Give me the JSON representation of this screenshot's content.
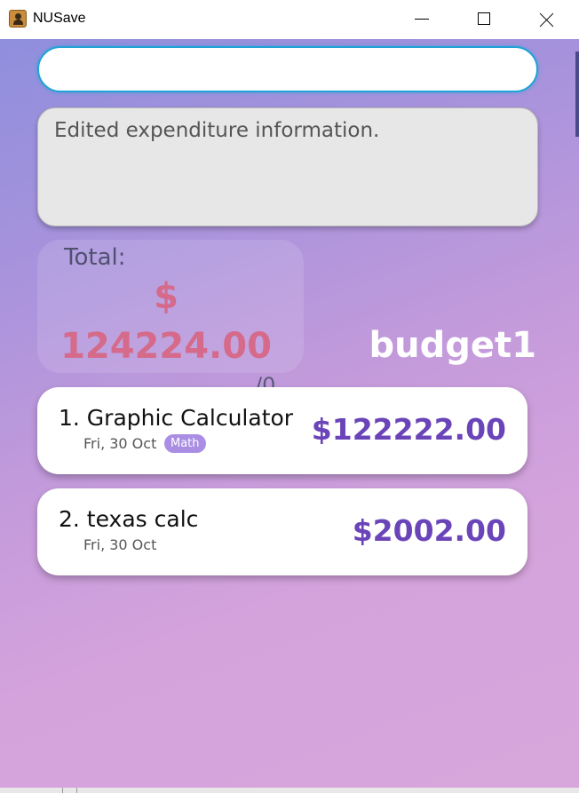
{
  "window": {
    "title": "NUSave",
    "icon": "address-book-icon"
  },
  "command": {
    "value": "",
    "placeholder": ""
  },
  "result": {
    "text": "Edited expenditure information."
  },
  "summary": {
    "total_label": "Total:",
    "currency_symbol": "$",
    "total_value": "124224.00",
    "page_indicator": "/0",
    "budget_name": "budget1"
  },
  "expenditures": [
    {
      "name": "1. Graphic Calculator",
      "date": "Fri, 30 Oct",
      "tag": "Math",
      "amount": "$122222.00"
    },
    {
      "name": "2. texas calc",
      "date": "Fri, 30 Oct",
      "tag": "",
      "amount": "$2002.00"
    }
  ],
  "colors": {
    "accent_border": "#1fa3d6",
    "amount_text": "#6a44b8",
    "total_text": "#d56a8a",
    "tag_bg": "#a98ee4"
  }
}
